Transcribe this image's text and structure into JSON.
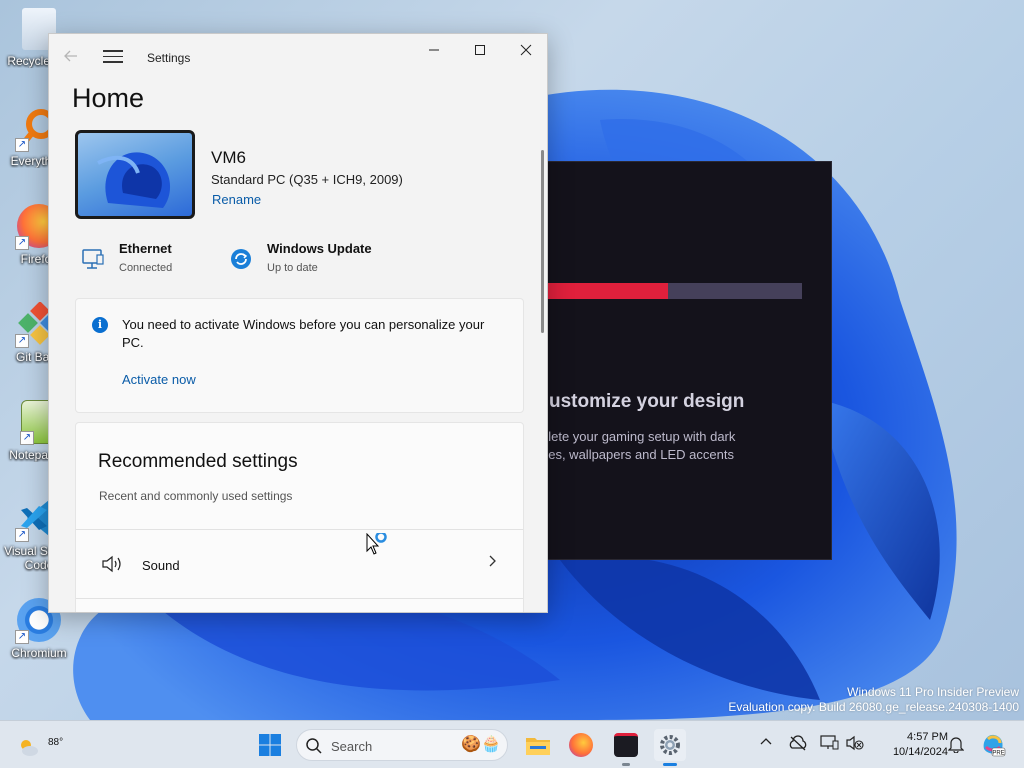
{
  "desktop": {
    "icons": [
      {
        "label": "Recycle Bin",
        "icon": "recycle-bin-icon"
      },
      {
        "label": "Everything",
        "icon": "everything-search-icon"
      },
      {
        "label": "Firefox",
        "icon": "firefox-icon"
      },
      {
        "label": "Git Bash",
        "icon": "git-bash-icon"
      },
      {
        "label": "Notepad++",
        "icon": "notepad-plus-icon"
      },
      {
        "label": "Visual Studio Code",
        "icon": "vscode-icon"
      },
      {
        "label": "Chromium",
        "icon": "chromium-icon"
      }
    ],
    "watermark_line1": "Windows 11 Pro Insider Preview",
    "watermark_line2": "Evaluation copy. Build 26080.ge_release.240308-1400"
  },
  "background_app": {
    "title": "ustomize your design",
    "subtitle": "plete your gaming setup with dark\nnes, wallpapers and LED accents",
    "progress_fraction": 0.48,
    "accent_color": "#e0203c"
  },
  "settings": {
    "window_title": "Settings",
    "page_title": "Home",
    "device": {
      "name": "VM6",
      "spec": "Standard PC (Q35 + ICH9, 2009)",
      "rename_label": "Rename"
    },
    "network": {
      "title": "Ethernet",
      "status": "Connected"
    },
    "update": {
      "title": "Windows Update",
      "status": "Up to date"
    },
    "activation": {
      "message": "You need to activate Windows before you can personalize your PC.",
      "link": "Activate now"
    },
    "recommended": {
      "title": "Recommended settings",
      "subtitle": "Recent and commonly used settings",
      "items": [
        {
          "label": "Sound",
          "icon": "speaker-icon"
        }
      ]
    }
  },
  "taskbar": {
    "weather_temp": "88°",
    "search_placeholder": "Search",
    "clock_time": "4:57 PM",
    "clock_date": "10/14/2024",
    "accent": "#0a6fd0"
  }
}
